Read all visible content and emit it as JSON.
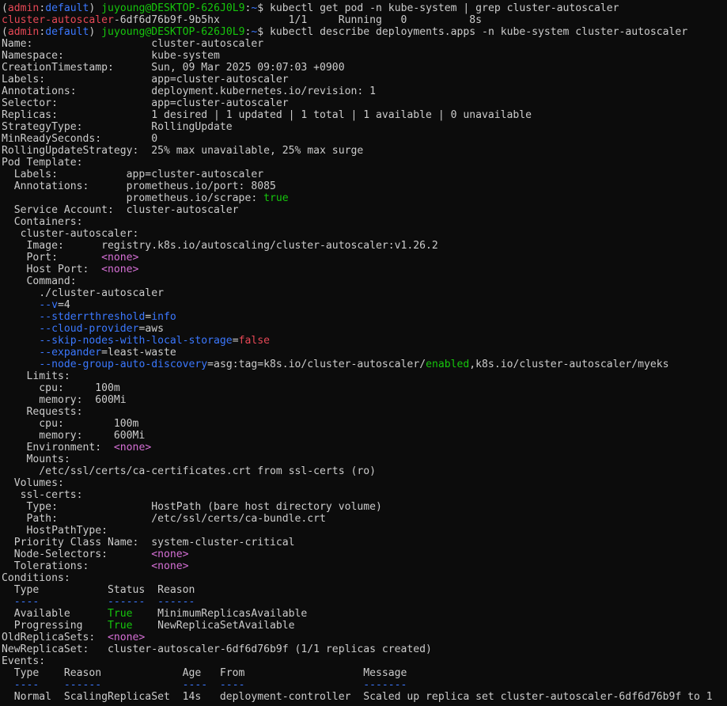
{
  "colors": {
    "background": "#0c0c0c",
    "default": "#cccccc",
    "red": "#e74856",
    "blue": "#3b78ff",
    "yellow": "#f9f1a5",
    "green": "#16c60c",
    "magenta": "#d670d6",
    "cyan": "#61d6d6"
  },
  "terminal": {
    "lines": [
      [
        [
          "(",
          "default"
        ],
        [
          "admin",
          "red"
        ],
        [
          ":",
          "default"
        ],
        [
          "default",
          "blue"
        ],
        [
          ") ",
          "default"
        ],
        [
          "juyoung@DESKTOP-626J0L9",
          "green"
        ],
        [
          ":",
          "default"
        ],
        [
          "~",
          "blue"
        ],
        [
          "$ kubectl get pod -n kube-system | grep cluster-autoscaler",
          "default"
        ]
      ],
      [
        [
          "cluster-autoscaler",
          "red"
        ],
        [
          "-6df6d76b9f-9b5hx           1/1     Running   0          8s",
          "default"
        ]
      ],
      [
        [
          "(",
          "default"
        ],
        [
          "admin",
          "red"
        ],
        [
          ":",
          "default"
        ],
        [
          "default",
          "blue"
        ],
        [
          ") ",
          "default"
        ],
        [
          "juyoung@DESKTOP-626J0L9",
          "green"
        ],
        [
          ":",
          "default"
        ],
        [
          "~",
          "blue"
        ],
        [
          "$ kubectl describe deployments.apps -n kube-system cluster-autoscaler",
          "default"
        ]
      ],
      [
        [
          "Name:                   cluster-autoscaler",
          "default"
        ]
      ],
      [
        [
          "Namespace:              kube-system",
          "default"
        ]
      ],
      [
        [
          "CreationTimestamp:      Sun, 09 Mar 2025 09:07:03 +0900",
          "default"
        ]
      ],
      [
        [
          "Labels:                 app=cluster-autoscaler",
          "default"
        ]
      ],
      [
        [
          "Annotations:            deployment.kubernetes.io/revision: 1",
          "default"
        ]
      ],
      [
        [
          "Selector:               app=cluster-autoscaler",
          "default"
        ]
      ],
      [
        [
          "Replicas:               1 desired | 1 updated | 1 total | 1 available | 0 unavailable",
          "default"
        ]
      ],
      [
        [
          "StrategyType:           RollingUpdate",
          "default"
        ]
      ],
      [
        [
          "MinReadySeconds:        0",
          "default"
        ]
      ],
      [
        [
          "RollingUpdateStrategy:  25% max unavailable, 25% max surge",
          "default"
        ]
      ],
      [
        [
          "Pod Template:",
          "default"
        ]
      ],
      [
        [
          "  Labels:           app=cluster-autoscaler",
          "default"
        ]
      ],
      [
        [
          "  Annotations:      prometheus.io/port: 8085",
          "default"
        ]
      ],
      [
        [
          "                    prometheus.io/scrape: ",
          "default"
        ],
        [
          "true",
          "green"
        ]
      ],
      [
        [
          "  Service Account:  cluster-autoscaler",
          "default"
        ]
      ],
      [
        [
          "  Containers:",
          "default"
        ]
      ],
      [
        [
          "   cluster-autoscaler:",
          "default"
        ]
      ],
      [
        [
          "    Image:      registry.k8s.io/autoscaling/cluster-autoscaler:v1.26.2",
          "default"
        ]
      ],
      [
        [
          "    Port:       ",
          "default"
        ],
        [
          "<none>",
          "magenta"
        ]
      ],
      [
        [
          "    Host Port:  ",
          "default"
        ],
        [
          "<none>",
          "magenta"
        ]
      ],
      [
        [
          "    Command:",
          "default"
        ]
      ],
      [
        [
          "      ./cluster-autoscaler",
          "default"
        ]
      ],
      [
        [
          "      ",
          "default"
        ],
        [
          "--v",
          "blue"
        ],
        [
          "=4",
          "default"
        ]
      ],
      [
        [
          "      ",
          "default"
        ],
        [
          "--stderrthreshold",
          "blue"
        ],
        [
          "=",
          "default"
        ],
        [
          "info",
          "blue"
        ]
      ],
      [
        [
          "      ",
          "default"
        ],
        [
          "--cloud-provider",
          "blue"
        ],
        [
          "=aws",
          "default"
        ]
      ],
      [
        [
          "      ",
          "default"
        ],
        [
          "--skip-nodes-with-local-storage",
          "blue"
        ],
        [
          "=",
          "default"
        ],
        [
          "false",
          "red"
        ]
      ],
      [
        [
          "      ",
          "default"
        ],
        [
          "--expander",
          "blue"
        ],
        [
          "=least-waste",
          "default"
        ]
      ],
      [
        [
          "      ",
          "default"
        ],
        [
          "--node-group-auto-discovery",
          "blue"
        ],
        [
          "=asg:tag=k8s.io/cluster-autoscaler/",
          "default"
        ],
        [
          "enabled",
          "green"
        ],
        [
          ",k8s.io/cluster-autoscaler/myeks",
          "default"
        ]
      ],
      [
        [
          "    Limits:",
          "default"
        ]
      ],
      [
        [
          "      cpu:     100m",
          "default"
        ]
      ],
      [
        [
          "      memory:  600Mi",
          "default"
        ]
      ],
      [
        [
          "    Requests:",
          "default"
        ]
      ],
      [
        [
          "      cpu:        100m",
          "default"
        ]
      ],
      [
        [
          "      memory:     600Mi",
          "default"
        ]
      ],
      [
        [
          "    Environment:  ",
          "default"
        ],
        [
          "<none>",
          "magenta"
        ]
      ],
      [
        [
          "    Mounts:",
          "default"
        ]
      ],
      [
        [
          "      /etc/ssl/certs/ca-certificates.crt from ssl-certs (ro)",
          "default"
        ]
      ],
      [
        [
          "  Volumes:",
          "default"
        ]
      ],
      [
        [
          "   ssl-certs:",
          "default"
        ]
      ],
      [
        [
          "    Type:               HostPath (bare host directory volume)",
          "default"
        ]
      ],
      [
        [
          "    Path:               /etc/ssl/certs/ca-bundle.crt",
          "default"
        ]
      ],
      [
        [
          "    HostPathType:",
          "default"
        ]
      ],
      [
        [
          "  Priority Class Name:  system-cluster-critical",
          "default"
        ]
      ],
      [
        [
          "  Node-Selectors:       ",
          "default"
        ],
        [
          "<none>",
          "magenta"
        ]
      ],
      [
        [
          "  Tolerations:          ",
          "default"
        ],
        [
          "<none>",
          "magenta"
        ]
      ],
      [
        [
          "Conditions:",
          "default"
        ]
      ],
      [
        [
          "  Type           Status  Reason",
          "default"
        ]
      ],
      [
        [
          "  ",
          "default"
        ],
        [
          "----           ------  ------",
          "blue"
        ]
      ],
      [
        [
          "  Available      ",
          "default"
        ],
        [
          "True",
          "green"
        ],
        [
          "    MinimumReplicasAvailable",
          "default"
        ]
      ],
      [
        [
          "  Progressing    ",
          "default"
        ],
        [
          "True",
          "green"
        ],
        [
          "    NewReplicaSetAvailable",
          "default"
        ]
      ],
      [
        [
          "OldReplicaSets:  ",
          "default"
        ],
        [
          "<none>",
          "magenta"
        ]
      ],
      [
        [
          "NewReplicaSet:   cluster-autoscaler-6df6d76b9f (1/1 replicas created)",
          "default"
        ]
      ],
      [
        [
          "Events:",
          "default"
        ]
      ],
      [
        [
          "  Type    Reason             Age   From                   Message",
          "default"
        ]
      ],
      [
        [
          "  ",
          "default"
        ],
        [
          "----    ------             ----  ----                   -------",
          "blue"
        ]
      ],
      [
        [
          "  Normal  ScalingReplicaSet  14s   deployment-controller  Scaled up replica set cluster-autoscaler-6df6d76b9f to 1",
          "default"
        ]
      ]
    ]
  }
}
